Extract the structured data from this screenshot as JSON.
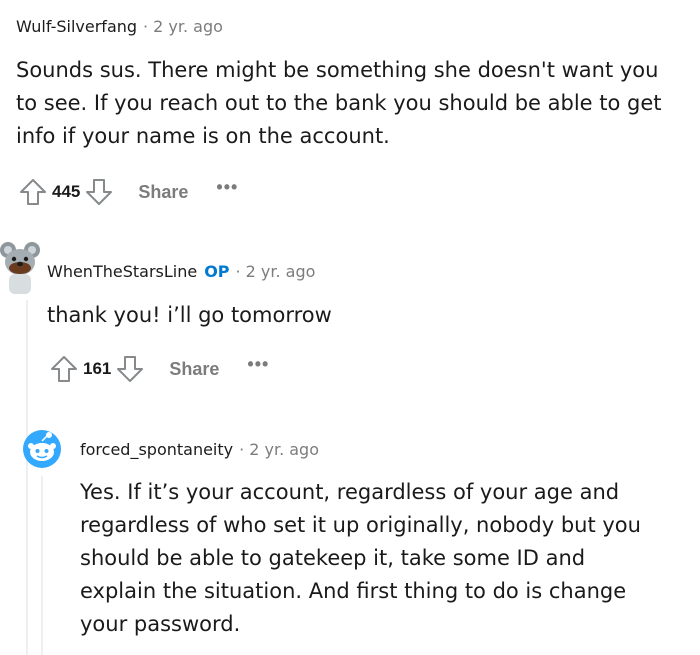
{
  "comments": [
    {
      "username": "Wulf-Silverfang",
      "separator": "·",
      "time": "2 yr. ago",
      "lines": [
        "Sounds sus. There might be something she doesn't want you",
        "to see. If you reach out to the bank you should be able to get",
        "info if your name is on the account."
      ],
      "score": "445",
      "share_label": "Share",
      "more_label": "•••"
    },
    {
      "username": "WhenTheStarsLine",
      "op_badge": "OP",
      "separator": "·",
      "time": "2 yr. ago",
      "lines": [
        "thank you! i’ll go tomorrow"
      ],
      "score": "161",
      "share_label": "Share",
      "more_label": "•••"
    },
    {
      "username": "forced_spontaneity",
      "separator": "·",
      "time": "2 yr. ago",
      "lines": [
        "Yes. If it’s your account, regardless of your age and",
        "regardless of who set it up originally, nobody but you",
        "should be able to gatekeep it, take some ID and",
        "explain the situation. And first thing to do is change",
        "your password."
      ]
    }
  ],
  "icons": {
    "upvote": "upvote-arrow-icon",
    "downvote": "downvote-arrow-icon",
    "more": "more-options-icon",
    "avatar_koala": "koala-avatar-icon",
    "avatar_snoo": "snoo-avatar-icon"
  },
  "colors": {
    "op_badge": "#0079d3",
    "meta_gray": "#7c7c7c",
    "thread_line": "#edeff1",
    "snoo_blue": "#33a8ff"
  }
}
